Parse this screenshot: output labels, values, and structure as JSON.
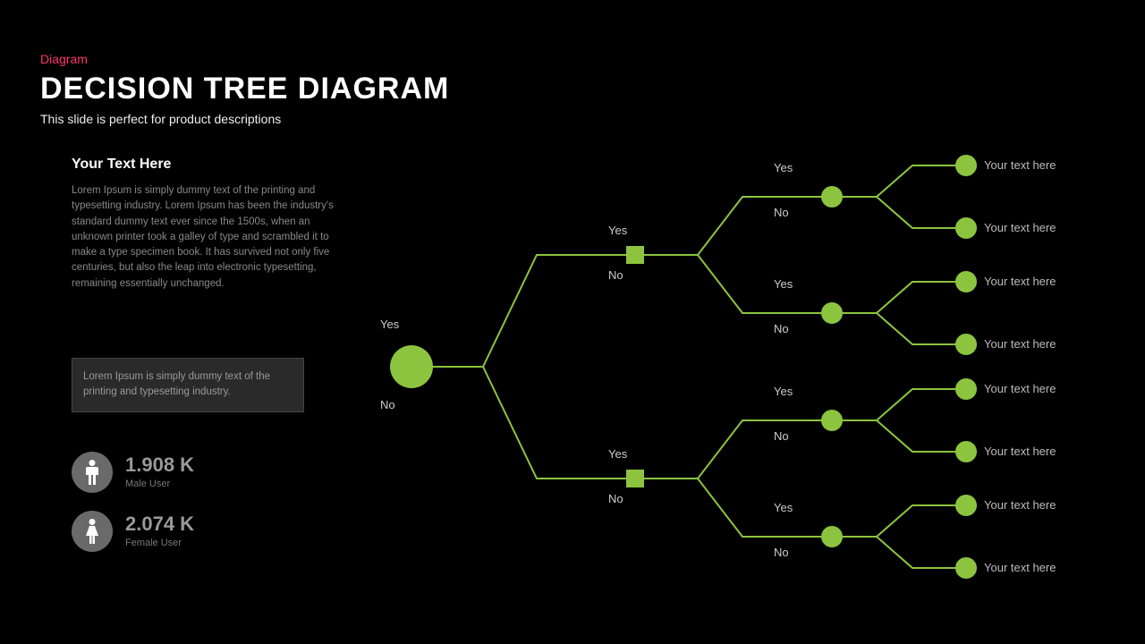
{
  "category": "Diagram",
  "title": "DECISION TREE DIAGRAM",
  "subtitle": "This slide is perfect for product descriptions",
  "textBlock": {
    "heading": "Your Text Here",
    "body": "Lorem Ipsum is simply dummy text of the printing and typesetting industry. Lorem Ipsum has been the industry's standard dummy text ever since the 1500s, when an unknown printer took a galley of type and scrambled it to make a type specimen book. It has survived not only five centuries, but also the leap into electronic typesetting, remaining essentially unchanged."
  },
  "callout": "Lorem Ipsum is simply dummy text of the printing and typesetting industry.",
  "stats": [
    {
      "value": "1.908 K",
      "label": "Male User"
    },
    {
      "value": "2.074 K",
      "label": "Female User"
    }
  ],
  "tree": {
    "root": {
      "yes": "Yes",
      "no": "No"
    },
    "level2": {
      "top": {
        "yes": "Yes",
        "no": "No"
      },
      "bottom": {
        "yes": "Yes",
        "no": "No"
      }
    },
    "level3": [
      {
        "yes": "Yes",
        "no": "No"
      },
      {
        "yes": "Yes",
        "no": "No"
      },
      {
        "yes": "Yes",
        "no": "No"
      },
      {
        "yes": "Yes",
        "no": "No"
      }
    ],
    "leaves": [
      "Your text here",
      "Your text here",
      "Your text here",
      "Your text here",
      "Your text here",
      "Your text here",
      "Your text here",
      "Your text here"
    ]
  },
  "colors": {
    "accent": "#8cc43f",
    "nodeFill": "#8cc43f"
  }
}
